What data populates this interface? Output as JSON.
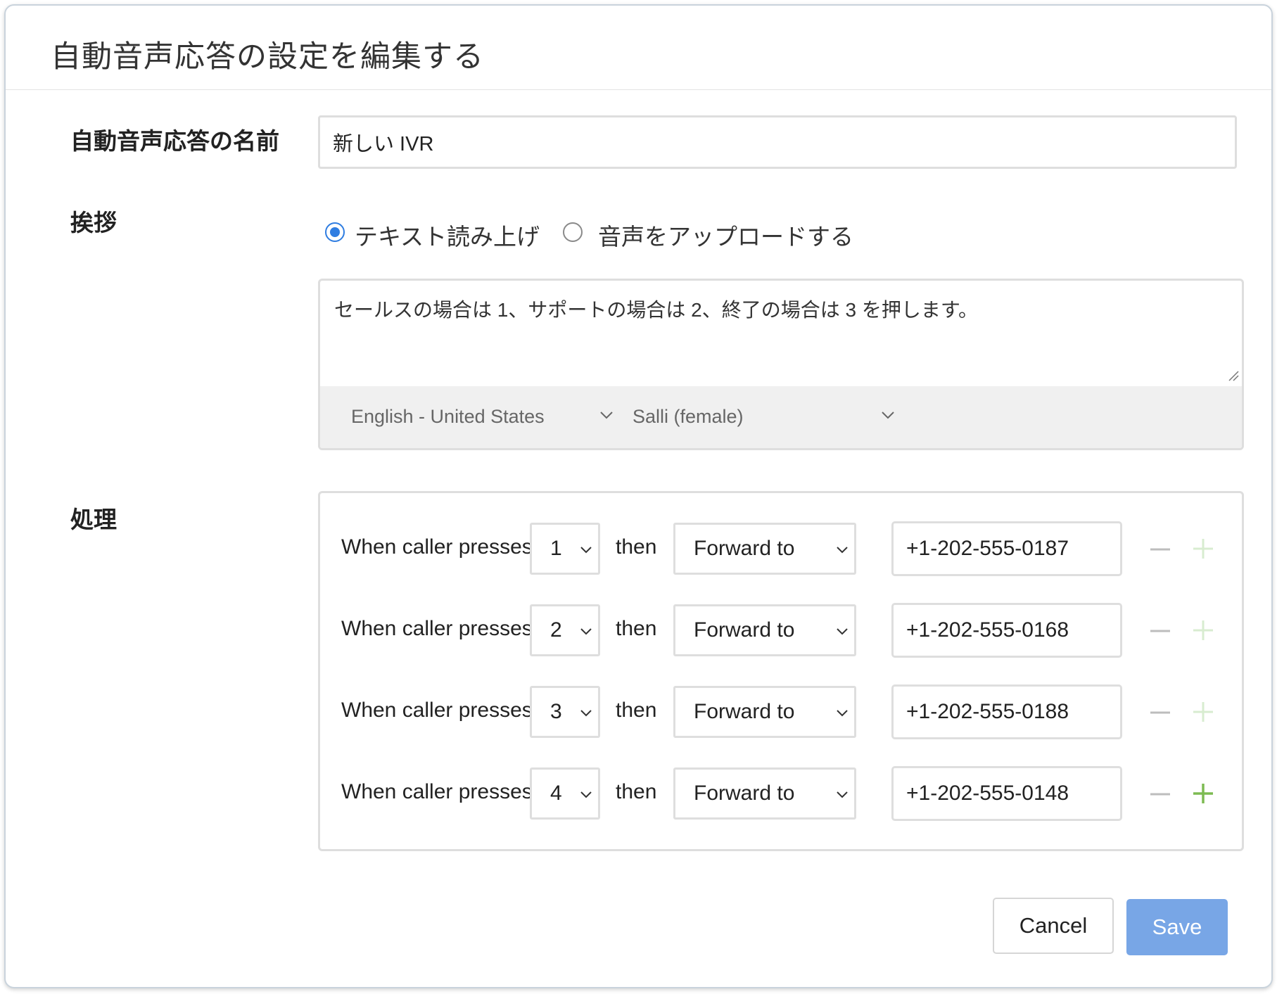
{
  "dialog": {
    "title": "自動音声応答の設定を編集する"
  },
  "name_field": {
    "label": "自動音声応答の名前",
    "value": "新しい IVR"
  },
  "greeting": {
    "label": "挨拶",
    "options": [
      {
        "label": "テキスト読み上げ",
        "selected": true
      },
      {
        "label": "音声をアップロードする",
        "selected": false
      }
    ],
    "text": "セールスの場合は 1、サポートの場合は 2、終了の場合は 3 を押します。",
    "language": "English - United States",
    "voice": "Salli (female)"
  },
  "actions": {
    "label": "処理",
    "rules": [
      {
        "prefix": "When caller presses",
        "key": "1",
        "then": "then",
        "action": "Forward to",
        "number": "+1-202-555-0187",
        "add_enabled": false
      },
      {
        "prefix": "When caller presses",
        "key": "2",
        "then": "then",
        "action": "Forward to",
        "number": "+1-202-555-0168",
        "add_enabled": false
      },
      {
        "prefix": "When caller presses",
        "key": "3",
        "then": "then",
        "action": "Forward to",
        "number": "+1-202-555-0188",
        "add_enabled": false
      },
      {
        "prefix": "When caller presses",
        "key": "4",
        "then": "then",
        "action": "Forward to",
        "number": "+1-202-555-0148",
        "add_enabled": true
      }
    ]
  },
  "footer": {
    "cancel_label": "Cancel",
    "save_label": "Save"
  },
  "colors": {
    "accent": "#2f7de1",
    "save_button": "#78a6e6",
    "plus_active": "#7dbb52",
    "plus_disabled": "#d8ecd0",
    "minus": "#bdbdbd"
  },
  "icons": {
    "minus": "minus-icon",
    "plus": "plus-icon",
    "chevron": "chevron-down-icon",
    "resize": "resize-handle-icon"
  }
}
